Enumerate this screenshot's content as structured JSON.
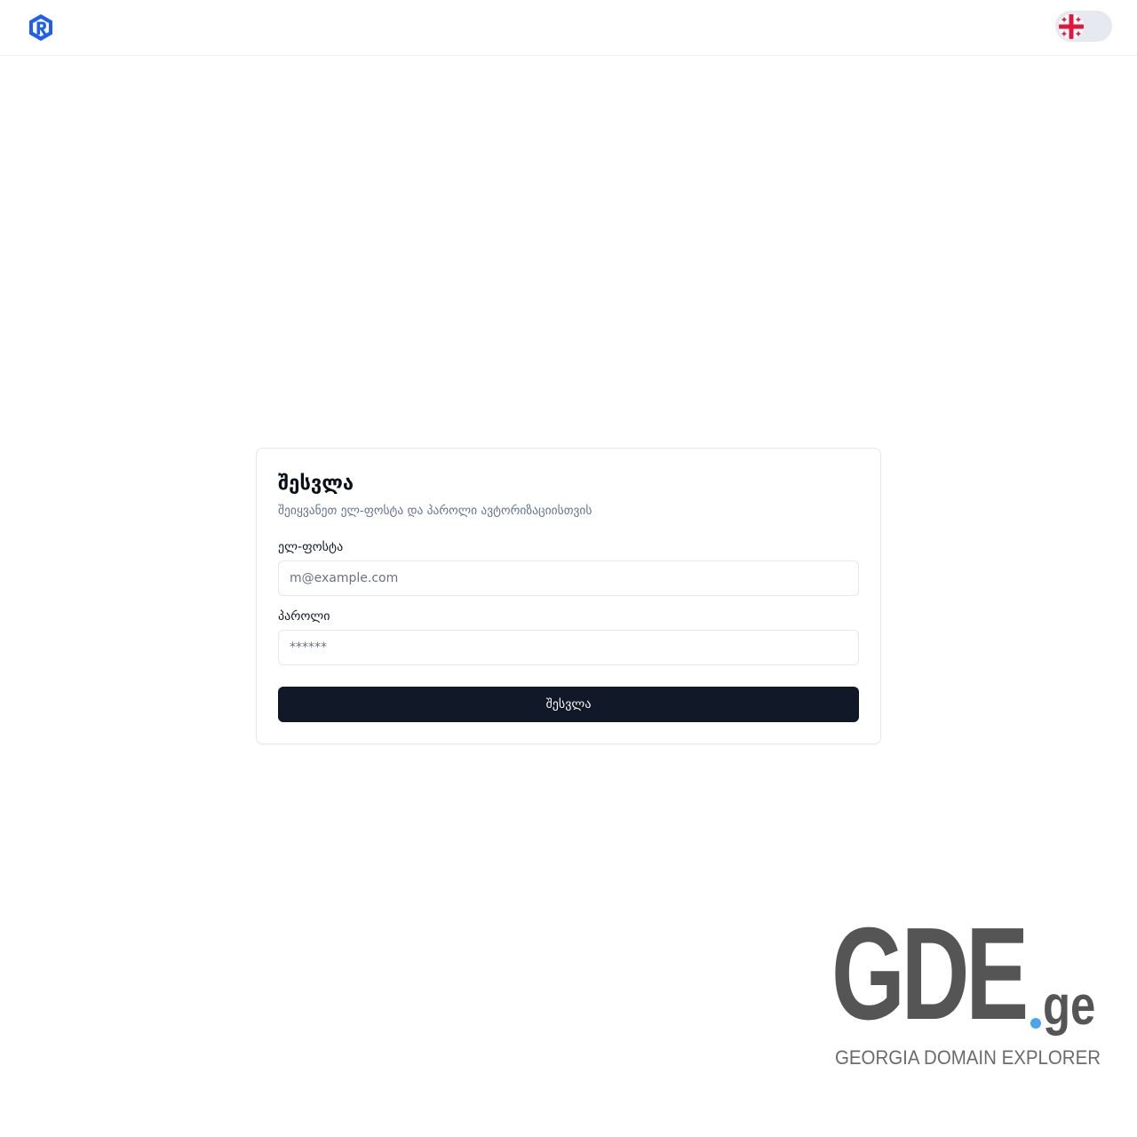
{
  "header": {
    "logo_icon": "r-logo-icon",
    "logo_color": "#1f5ef5",
    "language_toggle": {
      "flag_icon": "georgia-flag-icon",
      "flag_color": "#e0173d"
    }
  },
  "login": {
    "title": "შესვლა",
    "subtitle": "შეიყვანეთ ელ-ფოსტა და პაროლი ავტორიზაციისთვის",
    "email": {
      "label": "ელ-ფოსტა",
      "placeholder": "m@example.com",
      "value": ""
    },
    "password": {
      "label": "პაროლი",
      "placeholder": "******",
      "value": ""
    },
    "submit_label": "შესვლა",
    "button_color": "#111827"
  },
  "brand": {
    "mark": "GDE",
    "tld": "ge",
    "tagline": "GEORGIA DOMAIN EXPLORER",
    "dot_color": "#4da3ee",
    "text_color": "#555555"
  }
}
